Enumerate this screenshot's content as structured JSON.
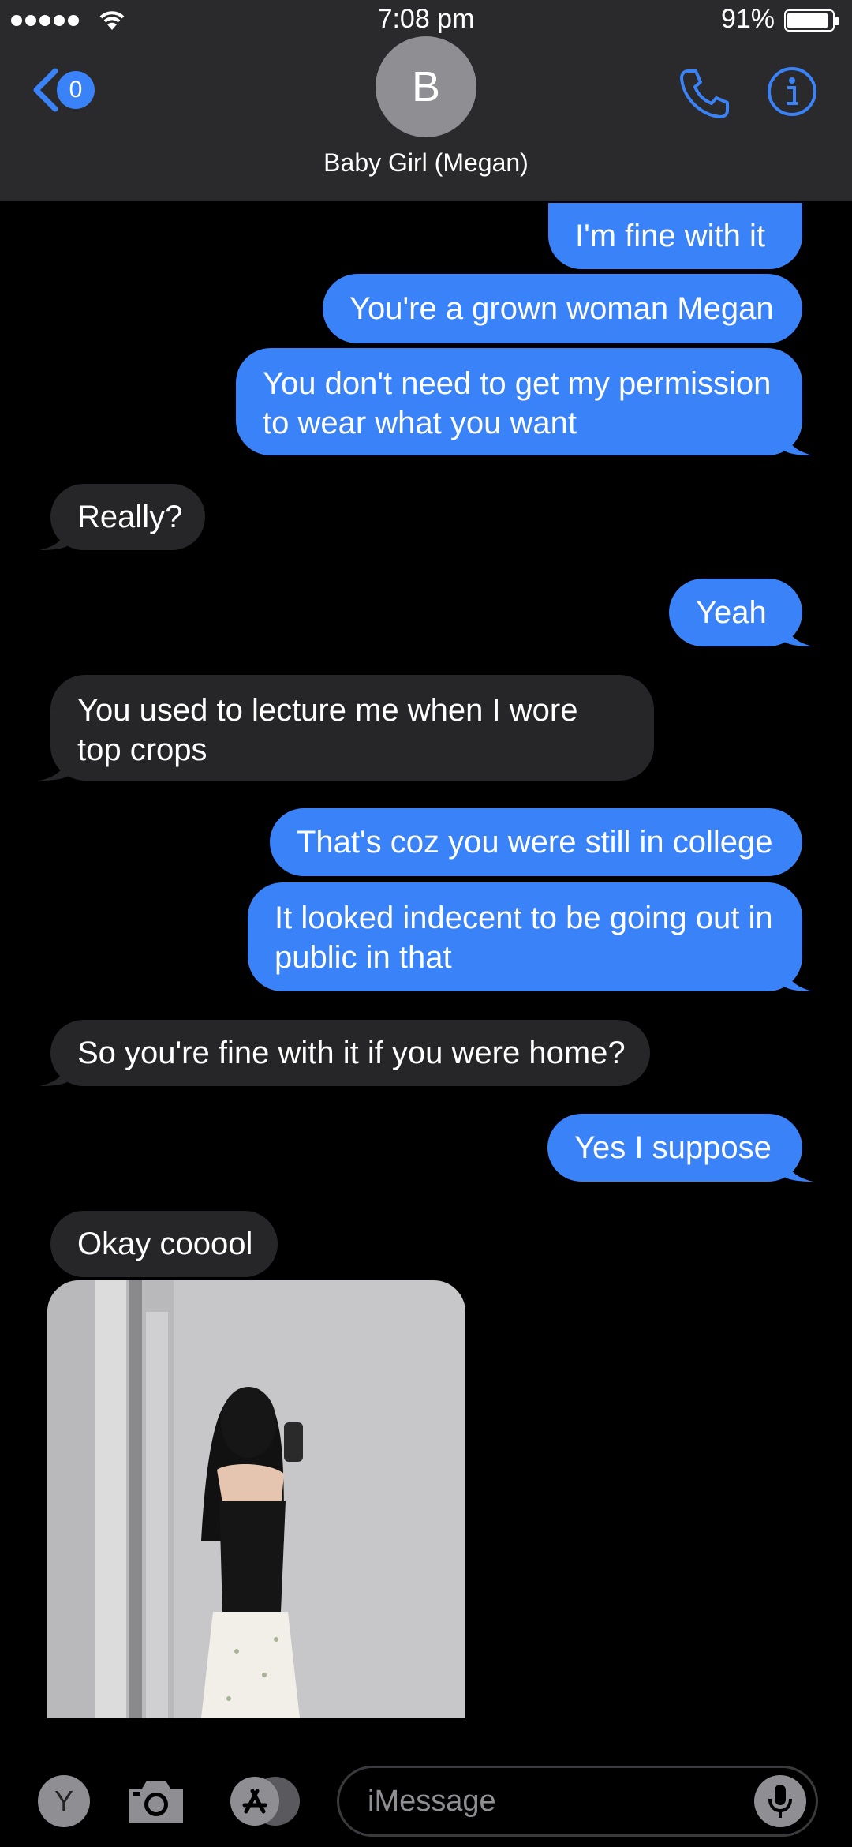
{
  "status_bar": {
    "time": "7:08 pm",
    "battery": "91%"
  },
  "header": {
    "back_badge": "0",
    "avatar_initial": "B",
    "contact_name": "Baby Girl (Megan)",
    "accent_color": "#3a82f7"
  },
  "messages": [
    {
      "from": "me",
      "text": "I'm fine with it"
    },
    {
      "from": "me",
      "text": "You're a grown woman Megan"
    },
    {
      "from": "me",
      "text": "You don't need to get my permission to wear what you want"
    },
    {
      "from": "them",
      "text": "Really?"
    },
    {
      "from": "me",
      "text": "Yeah"
    },
    {
      "from": "them",
      "text": "You used to lecture me when I wore top crops"
    },
    {
      "from": "me",
      "text": "That's coz you were still in college"
    },
    {
      "from": "me",
      "text": "It looked indecent to be going out in public in that"
    },
    {
      "from": "them",
      "text": "So you're fine with it if you were home?"
    },
    {
      "from": "me",
      "text": "Yes I suppose"
    },
    {
      "from": "them",
      "text": "Okay cooool"
    }
  ],
  "input_bar": {
    "app_y": "Y",
    "placeholder": "iMessage"
  }
}
